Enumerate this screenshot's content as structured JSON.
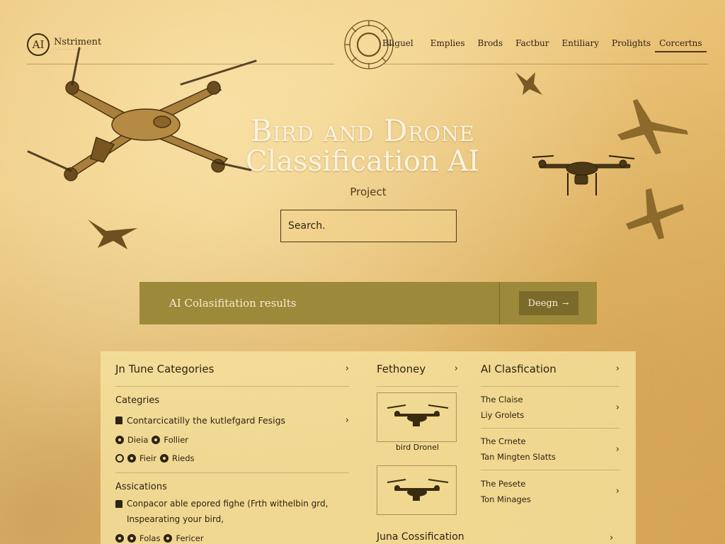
{
  "header": {
    "logo_mark": "AI",
    "logo_name": "Nstriment",
    "nav": [
      "BIiguel",
      "Emplies",
      "Brods",
      "Factbur",
      "Entiliary",
      "Prolights",
      "Corcertns"
    ]
  },
  "hero": {
    "title_line1": "Bird and Drone",
    "title_line2": "Classification AI",
    "subtitle": "Project",
    "search_placeholder": "Search."
  },
  "banner": {
    "label": "AI Colasifitation results",
    "button_label": "Deegn",
    "button_arrow": "→"
  },
  "panel": {
    "col_a": {
      "title": "Jn Tune Categories",
      "section1": {
        "title": "Categries",
        "link": "Contarcicatilly the kutlefgard Fesigs",
        "chips_row1": [
          "Dieia",
          "Follier"
        ],
        "chips_row2": [
          "Fieir",
          "Rieds"
        ]
      },
      "section2": {
        "title": "Assications",
        "body_line1": "Conpacor able epored fighe (Frth withelbin grd,",
        "body_line2": "Inspearating your bird,",
        "chips_row": [
          "Folas",
          "Fericer"
        ]
      }
    },
    "col_b": {
      "title": "Fethoney",
      "card1_caption": "bird Dronel",
      "card2_caption": "",
      "footer": "Juna Cossification"
    },
    "col_c": {
      "title": "AI Clasfication",
      "items": [
        {
          "line1": "The Claise",
          "line2": "Liy Grolets"
        },
        {
          "line1": "The Crnete",
          "line2": "Tan Mingten Slatts"
        },
        {
          "line1": "The Pesete",
          "line2": "Ton Minages"
        }
      ]
    },
    "chevron": "›"
  },
  "colors": {
    "parchment": "#ebc47a",
    "banner": "#9c8a3a",
    "banner_button": "#7a6b2a",
    "ink": "#2e2412"
  }
}
